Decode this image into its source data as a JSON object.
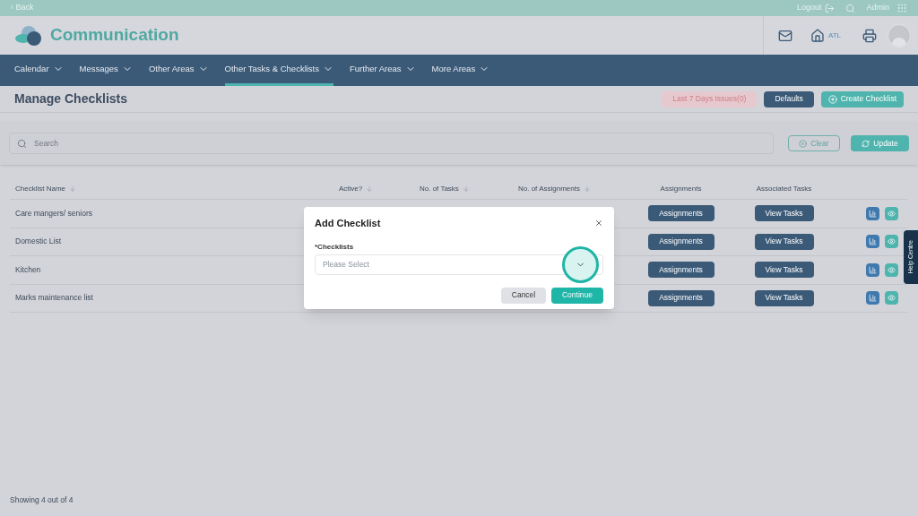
{
  "top_bar": {
    "back": "‹ Back",
    "logout": "Logout",
    "user": "Admin"
  },
  "header": {
    "app_name": "Communication",
    "site": "ATL"
  },
  "nav": [
    {
      "label": "Calendar",
      "selected": false
    },
    {
      "label": "Messages",
      "selected": false
    },
    {
      "label": "Other Areas",
      "selected": false
    },
    {
      "label": "Other Tasks & Checklists",
      "selected": true
    },
    {
      "label": "Further Areas",
      "selected": false
    },
    {
      "label": "More Areas",
      "selected": false
    }
  ],
  "page_title": "Manage Checklists",
  "actions": {
    "issues": "Last 7 Days Issues(0)",
    "defaults": "Defaults",
    "create": "Create Checklist"
  },
  "search": {
    "placeholder": "Search",
    "clear": "Clear",
    "update": "Update"
  },
  "table": {
    "columns": [
      {
        "label": "Checklist Name",
        "sortable": true
      },
      {
        "label": "Active?",
        "sortable": true
      },
      {
        "label": "No. of Tasks",
        "sortable": true
      },
      {
        "label": "No. of Assignments",
        "sortable": true
      },
      {
        "label": "Assignments",
        "sortable": false
      },
      {
        "label": "Associated Tasks",
        "sortable": false
      }
    ],
    "rows": [
      {
        "name": "Care mangers/ seniors",
        "assignments": "Assignments",
        "tasks": "View Tasks"
      },
      {
        "name": "Domestic List",
        "assignments": "Assignments",
        "tasks": "View Tasks"
      },
      {
        "name": "Kitchen",
        "assignments": "Assignments",
        "tasks": "View Tasks"
      },
      {
        "name": "Marks maintenance list",
        "assignments": "Assignments",
        "tasks": "View Tasks"
      }
    ]
  },
  "footer": "Showing 4 out of 4",
  "help": "Help Centre",
  "dialog": {
    "title": "Add Checklist",
    "label": "*Checklists",
    "placeholder": "Please Select",
    "cancel": "Cancel",
    "continue": "Continue"
  }
}
